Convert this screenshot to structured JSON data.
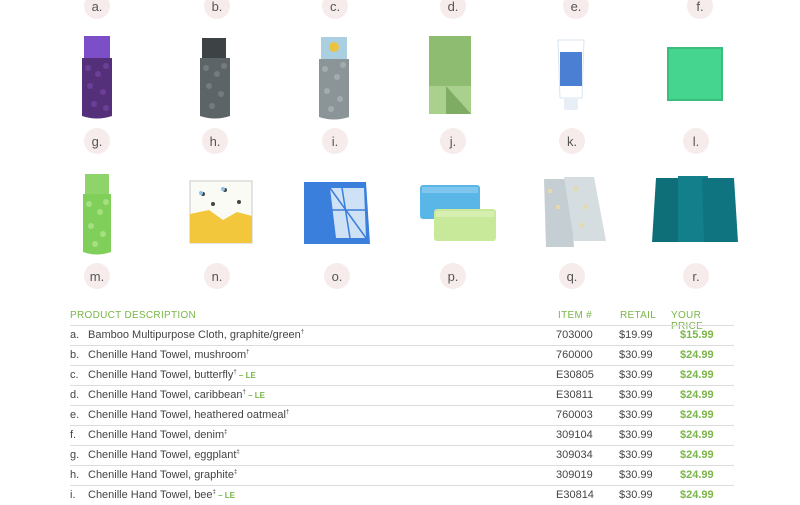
{
  "badges_row1": [
    "a.",
    "b.",
    "c.",
    "d.",
    "e.",
    "f."
  ],
  "badges_row2": [
    "g.",
    "h.",
    "i.",
    "j.",
    "k.",
    "l."
  ],
  "badges_row3": [
    "m.",
    "n.",
    "o.",
    "p.",
    "q.",
    "r."
  ],
  "table": {
    "headers": {
      "description": "PRODUCT DESCRIPTION",
      "item": "ITEM #",
      "retail": "RETAIL",
      "your_price": "YOUR PRICE"
    },
    "rows": [
      {
        "letter": "a.",
        "desc": "Bamboo Multipurpose Cloth, graphite/green",
        "mark": "†",
        "le": "",
        "item": "703000",
        "retail": "$19.99",
        "price": "$15.99"
      },
      {
        "letter": "b.",
        "desc": "Chenille Hand Towel, mushroom",
        "mark": "†",
        "le": "",
        "item": "760000",
        "retail": "$30.99",
        "price": "$24.99"
      },
      {
        "letter": "c.",
        "desc": "Chenille Hand Towel, butterfly",
        "mark": "†",
        "le": " – LE",
        "item": "E30805",
        "retail": "$30.99",
        "price": "$24.99"
      },
      {
        "letter": "d.",
        "desc": "Chenille Hand Towel, caribbean",
        "mark": "†",
        "le": " – LE",
        "item": "E30811",
        "retail": "$30.99",
        "price": "$24.99"
      },
      {
        "letter": "e.",
        "desc": "Chenille Hand Towel, heathered oatmeal",
        "mark": "†",
        "le": "",
        "item": "760003",
        "retail": "$30.99",
        "price": "$24.99"
      },
      {
        "letter": "f.",
        "desc": "Chenille Hand Towel, denim",
        "mark": "‡",
        "le": "",
        "item": "309104",
        "retail": "$30.99",
        "price": "$24.99"
      },
      {
        "letter": "g.",
        "desc": "Chenille Hand Towel, eggplant",
        "mark": "‡",
        "le": "",
        "item": "309034",
        "retail": "$30.99",
        "price": "$24.99"
      },
      {
        "letter": "h.",
        "desc": "Chenille Hand Towel, graphite",
        "mark": "‡",
        "le": "",
        "item": "309019",
        "retail": "$30.99",
        "price": "$24.99"
      },
      {
        "letter": "i.",
        "desc": "Chenille Hand Towel, bee",
        "mark": "‡",
        "le": " – LE",
        "item": "E30814",
        "retail": "$30.99",
        "price": "$24.99"
      }
    ]
  },
  "colors": {
    "accent_green": "#7ab648",
    "badge_bg": "#f7ecec"
  }
}
